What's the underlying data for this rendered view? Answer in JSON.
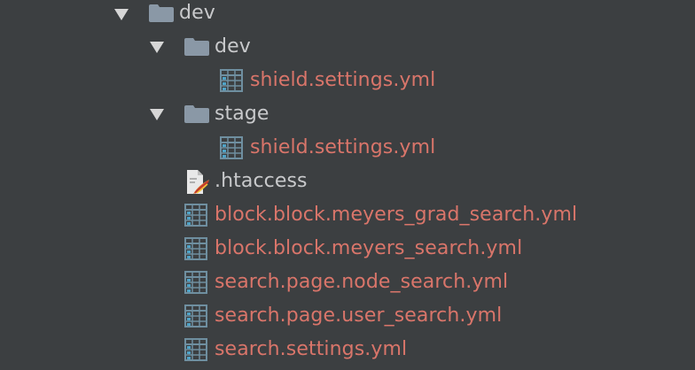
{
  "tree": {
    "root_folder": "dev",
    "dev_subfolder": "dev",
    "dev_file": "shield.settings.yml",
    "stage_subfolder": "stage",
    "stage_file": "shield.settings.yml",
    "htaccess_file": ".htaccess",
    "files": [
      "block.block.meyers_grad_search.yml",
      "block.block.meyers_search.yml",
      "search.page.node_search.yml",
      "search.page.user_search.yml",
      "search.settings.yml"
    ]
  },
  "colors": {
    "background": "#3c3f41",
    "modified_text": "#d9756a",
    "normal_text": "#c8c9cb",
    "folder_icon": "#8a98a6",
    "file_icon": "#6f8fa0"
  },
  "icons": {
    "expand": "chevron-down-icon",
    "folder": "folder-icon",
    "yml": "table-file-icon",
    "htaccess": "feather-file-icon"
  }
}
